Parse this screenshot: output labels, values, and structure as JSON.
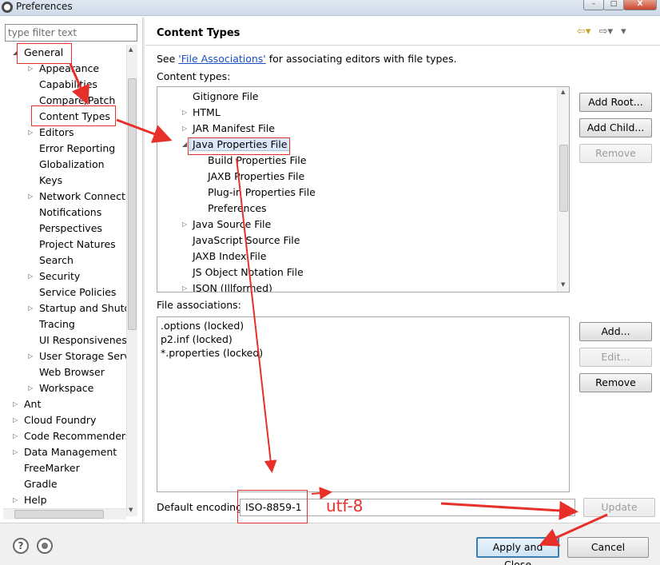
{
  "window": {
    "title": "Preferences",
    "min_glyph": "–",
    "max_glyph": "□",
    "close_glyph": "X"
  },
  "left": {
    "filter_placeholder": "type filter text",
    "tree": [
      {
        "label": "General",
        "level": 0,
        "arrow": "expanded"
      },
      {
        "label": "Appearance",
        "level": 1,
        "arrow": "collapsed"
      },
      {
        "label": "Capabilities",
        "level": 1,
        "arrow": "none"
      },
      {
        "label": "Compare/Patch",
        "level": 1,
        "arrow": "none"
      },
      {
        "label": "Content Types",
        "level": 1,
        "arrow": "none"
      },
      {
        "label": "Editors",
        "level": 1,
        "arrow": "collapsed"
      },
      {
        "label": "Error Reporting",
        "level": 1,
        "arrow": "none"
      },
      {
        "label": "Globalization",
        "level": 1,
        "arrow": "none"
      },
      {
        "label": "Keys",
        "level": 1,
        "arrow": "none"
      },
      {
        "label": "Network Connections",
        "level": 1,
        "arrow": "collapsed"
      },
      {
        "label": "Notifications",
        "level": 1,
        "arrow": "none"
      },
      {
        "label": "Perspectives",
        "level": 1,
        "arrow": "none"
      },
      {
        "label": "Project Natures",
        "level": 1,
        "arrow": "none"
      },
      {
        "label": "Search",
        "level": 1,
        "arrow": "none"
      },
      {
        "label": "Security",
        "level": 1,
        "arrow": "collapsed"
      },
      {
        "label": "Service Policies",
        "level": 1,
        "arrow": "none"
      },
      {
        "label": "Startup and Shutdown",
        "level": 1,
        "arrow": "collapsed"
      },
      {
        "label": "Tracing",
        "level": 1,
        "arrow": "none"
      },
      {
        "label": "UI Responsiveness",
        "level": 1,
        "arrow": "none"
      },
      {
        "label": "User Storage Service",
        "level": 1,
        "arrow": "collapsed"
      },
      {
        "label": "Web Browser",
        "level": 1,
        "arrow": "none"
      },
      {
        "label": "Workspace",
        "level": 1,
        "arrow": "collapsed"
      },
      {
        "label": "Ant",
        "level": 0,
        "arrow": "collapsed"
      },
      {
        "label": "Cloud Foundry",
        "level": 0,
        "arrow": "collapsed"
      },
      {
        "label": "Code Recommenders",
        "level": 0,
        "arrow": "collapsed"
      },
      {
        "label": "Data Management",
        "level": 0,
        "arrow": "collapsed"
      },
      {
        "label": "FreeMarker",
        "level": 0,
        "arrow": "none"
      },
      {
        "label": "Gradle",
        "level": 0,
        "arrow": "none"
      },
      {
        "label": "Help",
        "level": 0,
        "arrow": "collapsed"
      }
    ]
  },
  "right": {
    "title": "Content Types",
    "see_prefix": "See ",
    "see_link": "'File Associations'",
    "see_suffix": " for associating editors with file types.",
    "content_types_label": "Content types:",
    "content_types": [
      {
        "label": "Gitignore File",
        "level": 0,
        "arrow": "none"
      },
      {
        "label": "HTML",
        "level": 0,
        "arrow": "collapsed"
      },
      {
        "label": "JAR Manifest File",
        "level": 0,
        "arrow": "collapsed"
      },
      {
        "label": "Java Properties File",
        "level": 0,
        "arrow": "expanded",
        "selected": true
      },
      {
        "label": "Build Properties File",
        "level": 1,
        "arrow": "none"
      },
      {
        "label": "JAXB Properties File",
        "level": 1,
        "arrow": "none"
      },
      {
        "label": "Plug-in Properties File",
        "level": 1,
        "arrow": "none"
      },
      {
        "label": "Preferences",
        "level": 1,
        "arrow": "none"
      },
      {
        "label": "Java Source File",
        "level": 0,
        "arrow": "collapsed"
      },
      {
        "label": "JavaScript Source File",
        "level": 0,
        "arrow": "none"
      },
      {
        "label": "JAXB Index File",
        "level": 0,
        "arrow": "none"
      },
      {
        "label": "JS Object Notation File",
        "level": 0,
        "arrow": "none"
      },
      {
        "label": "JSON (Illformed)",
        "level": 0,
        "arrow": "collapsed"
      }
    ],
    "add_root_button": "Add Root...",
    "add_child_button": "Add Child...",
    "remove_type_button": "Remove",
    "file_associations_label": "File associations:",
    "file_associations": [
      ".options (locked)",
      "p2.inf (locked)",
      "*.properties (locked)"
    ],
    "add_assoc_button": "Add...",
    "edit_assoc_button": "Edit...",
    "remove_assoc_button": "Remove",
    "default_encoding_label": "Default encoding:",
    "default_encoding_value": "ISO-8859-1",
    "update_button": "Update"
  },
  "bottom": {
    "help_glyph": "?",
    "apply_close_button": "Apply and Close",
    "cancel_button": "Cancel"
  },
  "annotation": {
    "text": "utf-8",
    "color": "#e8302a"
  },
  "icons": [
    "eclipse-icon",
    "nav-back-icon",
    "nav-forward-icon",
    "menu-down-icon",
    "help-icon",
    "import-export-icon"
  ]
}
